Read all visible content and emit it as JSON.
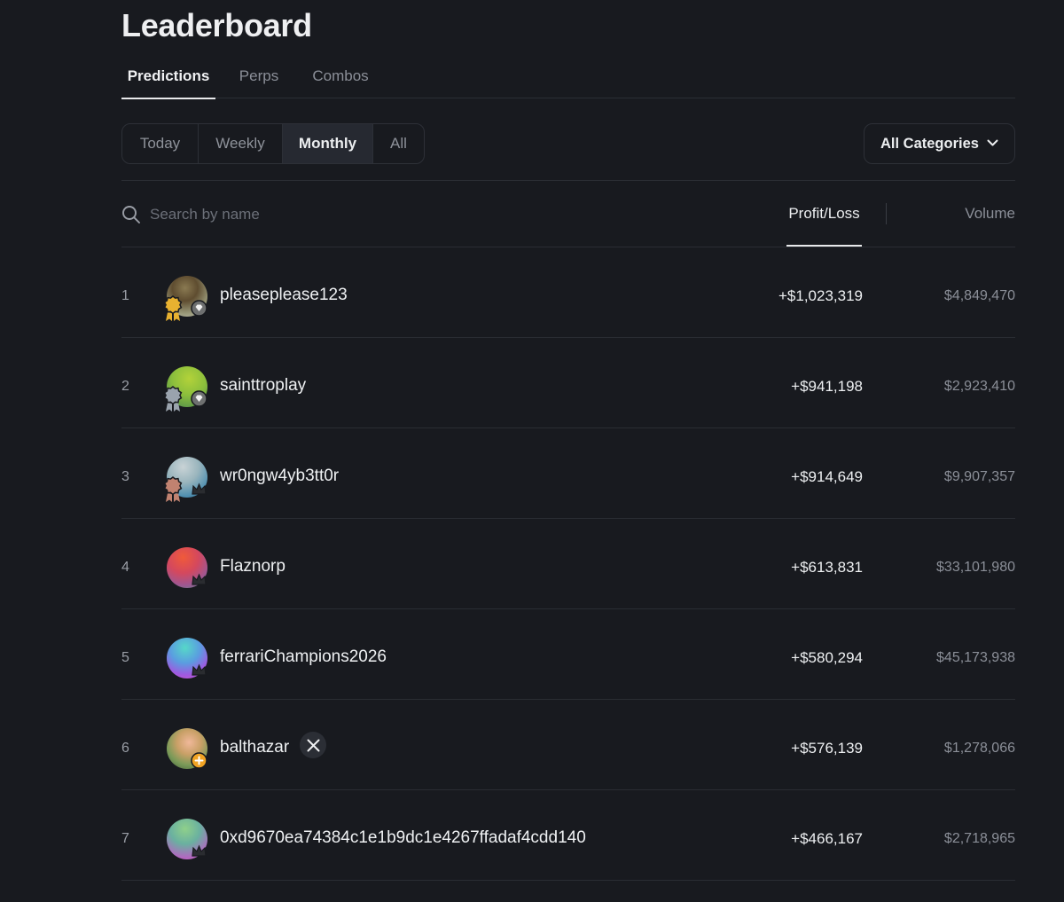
{
  "page": {
    "title": "Leaderboard"
  },
  "tabs": [
    {
      "label": "Predictions",
      "active": true
    },
    {
      "label": "Perps",
      "active": false
    },
    {
      "label": "Combos",
      "active": false
    }
  ],
  "periods": [
    {
      "label": "Today",
      "active": false
    },
    {
      "label": "Weekly",
      "active": false
    },
    {
      "label": "Monthly",
      "active": true
    },
    {
      "label": "All",
      "active": false
    }
  ],
  "category_filter": {
    "label": "All Categories",
    "icon": "chevron-down-icon"
  },
  "search": {
    "placeholder": "Search by name",
    "value": "",
    "icon": "search-icon"
  },
  "columns": {
    "profit_loss": {
      "label": "Profit/Loss",
      "active": true
    },
    "volume": {
      "label": "Volume",
      "active": false
    }
  },
  "rows": [
    {
      "rank": "1",
      "name": "pleaseplease123",
      "profit_loss": "+$1,023,319",
      "volume": "$4,849,470",
      "medal": "gold",
      "tier_icon": "diamond-icon"
    },
    {
      "rank": "2",
      "name": "sainttroplay",
      "profit_loss": "+$941,198",
      "volume": "$2,923,410",
      "medal": "silver",
      "tier_icon": "diamond-icon"
    },
    {
      "rank": "3",
      "name": "wr0ngw4yb3tt0r",
      "profit_loss": "+$914,649",
      "volume": "$9,907,357",
      "medal": "bronze",
      "tier_icon": "crown-icon"
    },
    {
      "rank": "4",
      "name": "Flaznorp",
      "profit_loss": "+$613,831",
      "volume": "$33,101,980",
      "medal": "",
      "tier_icon": "crown-icon"
    },
    {
      "rank": "5",
      "name": "ferrariChampions2026",
      "profit_loss": "+$580,294",
      "volume": "$45,173,938",
      "medal": "",
      "tier_icon": "crown-icon"
    },
    {
      "rank": "6",
      "name": "balthazar",
      "profit_loss": "+$576,139",
      "volume": "$1,278,066",
      "medal": "",
      "tier_icon": "plus-badge-icon",
      "social_icon": "x-logo-icon"
    },
    {
      "rank": "7",
      "name": "0xd9670ea74384c1e1b9dc1e4267ffadaf4cdd140",
      "profit_loss": "+$466,167",
      "volume": "$2,718,965",
      "medal": "",
      "tier_icon": "crown-icon"
    }
  ],
  "colors": {
    "background": "#181a1f",
    "text": "#e9eaec",
    "muted": "#8b8f98",
    "gold": "#e8b130",
    "silver": "#9aa3ad",
    "bronze": "#c08270",
    "plus_badge": "#f0a323"
  }
}
